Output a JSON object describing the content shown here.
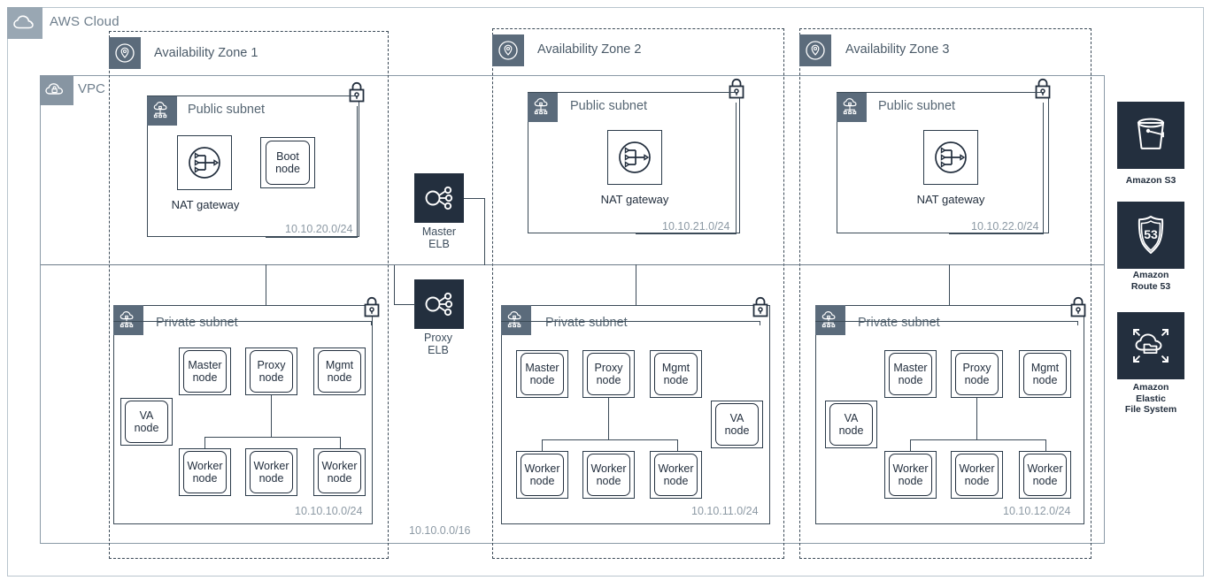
{
  "diagram": {
    "cloud_label": "AWS Cloud",
    "vpc_label": "VPC",
    "vpc_cidr": "10.10.0.0/16",
    "cloud_icon": "cloud-icon",
    "vpc_icon": "vpc-cloud-lock-icon"
  },
  "availability_zones": [
    {
      "name": "Availability Zone 1",
      "icon": "availability-zone-pin-icon",
      "public_subnet": {
        "title": "Public subnet",
        "cidr": "10.10.20.0/24",
        "icon": "public-subnet-icon",
        "lock_icon": "lock-icon",
        "nat_label": "NAT gateway",
        "nat_icon": "nat-gateway-icon",
        "extra_node": "Boot\nnode",
        "extra_node_line1": "Boot",
        "extra_node_line2": "node"
      },
      "private_subnet": {
        "title": "Private subnet",
        "cidr": "10.10.10.0/24",
        "icon": "private-subnet-icon",
        "lock_icon": "lock-icon",
        "va_position": "left",
        "nodes": {
          "master": {
            "l1": "Master",
            "l2": "node"
          },
          "proxy": {
            "l1": "Proxy",
            "l2": "node"
          },
          "mgmt": {
            "l1": "Mgmt",
            "l2": "node"
          },
          "va": {
            "l1": "VA",
            "l2": "node"
          },
          "worker1": {
            "l1": "Worker",
            "l2": "node"
          },
          "worker2": {
            "l1": "Worker",
            "l2": "node"
          },
          "worker3": {
            "l1": "Worker",
            "l2": "node"
          }
        }
      }
    },
    {
      "name": "Availability Zone 2",
      "icon": "availability-zone-pin-icon",
      "public_subnet": {
        "title": "Public subnet",
        "cidr": "10.10.21.0/24",
        "icon": "public-subnet-icon",
        "lock_icon": "lock-icon",
        "nat_label": "NAT gateway",
        "nat_icon": "nat-gateway-icon"
      },
      "private_subnet": {
        "title": "Private subnet",
        "cidr": "10.10.11.0/24",
        "icon": "private-subnet-icon",
        "lock_icon": "lock-icon",
        "va_position": "right",
        "nodes": {
          "master": {
            "l1": "Master",
            "l2": "node"
          },
          "proxy": {
            "l1": "Proxy",
            "l2": "node"
          },
          "mgmt": {
            "l1": "Mgmt",
            "l2": "node"
          },
          "va": {
            "l1": "VA",
            "l2": "node"
          },
          "worker1": {
            "l1": "Worker",
            "l2": "node"
          },
          "worker2": {
            "l1": "Worker",
            "l2": "node"
          },
          "worker3": {
            "l1": "Worker",
            "l2": "node"
          }
        }
      }
    },
    {
      "name": "Availability Zone 3",
      "icon": "availability-zone-pin-icon",
      "public_subnet": {
        "title": "Public subnet",
        "cidr": "10.10.22.0/24",
        "icon": "public-subnet-icon",
        "lock_icon": "lock-icon",
        "nat_label": "NAT gateway",
        "nat_icon": "nat-gateway-icon"
      },
      "private_subnet": {
        "title": "Private subnet",
        "cidr": "10.10.12.0/24",
        "icon": "private-subnet-icon",
        "lock_icon": "lock-icon",
        "va_position": "left",
        "nodes": {
          "master": {
            "l1": "Master",
            "l2": "node"
          },
          "proxy": {
            "l1": "Proxy",
            "l2": "node"
          },
          "mgmt": {
            "l1": "Mgmt",
            "l2": "node"
          },
          "va": {
            "l1": "VA",
            "l2": "node"
          },
          "worker1": {
            "l1": "Worker",
            "l2": "node"
          },
          "worker2": {
            "l1": "Worker",
            "l2": "node"
          },
          "worker3": {
            "l1": "Worker",
            "l2": "node"
          }
        }
      }
    }
  ],
  "load_balancers": [
    {
      "l1": "Master",
      "l2": "ELB",
      "icon": "elastic-load-balancer-icon"
    },
    {
      "l1": "Proxy",
      "l2": "ELB",
      "icon": "elastic-load-balancer-icon"
    }
  ],
  "services": [
    {
      "l1": "Amazon S3",
      "l2": "",
      "icon": "amazon-s3-bucket-icon"
    },
    {
      "l1": "Amazon",
      "l2": "Route 53",
      "icon": "amazon-route-53-icon"
    },
    {
      "l1": "Amazon",
      "l2": "Elastic",
      "l3": "File System",
      "icon": "amazon-efs-icon"
    }
  ],
  "colors": {
    "aws_navy": "#232F3E",
    "badge_gray": "#5b6b7b",
    "cloud_badge_gray": "#99a7b3",
    "border_gray": "#8a99a6",
    "text_gray": "#6e7e8c"
  }
}
